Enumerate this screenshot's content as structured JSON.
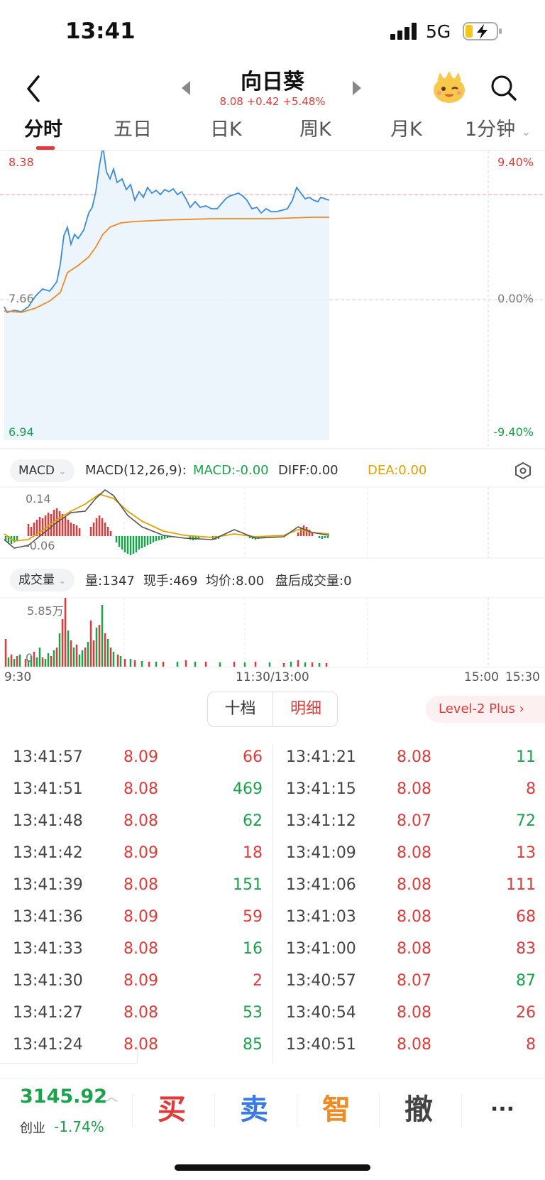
{
  "status_bar": {
    "time": "13:41",
    "network": "5G"
  },
  "header": {
    "stock_name": "向日葵",
    "quote": "8.08 +0.42 +5.48%"
  },
  "tabs": [
    {
      "label": "分时"
    },
    {
      "label": "五日"
    },
    {
      "label": "日K"
    },
    {
      "label": "周K"
    },
    {
      "label": "月K"
    },
    {
      "label": "1分钟"
    }
  ],
  "price_chart": {
    "high_price": "8.38",
    "mid_price": "7.66",
    "low_price": "6.94",
    "high_pct": "9.40%",
    "mid_pct": "0.00%",
    "low_pct": "-9.40%"
  },
  "macd": {
    "selector": "MACD",
    "params": "MACD(12,26,9):",
    "macd_value": "MACD:-0.00",
    "diff_value": "DIFF:0.00",
    "dea_value": "DEA:0.00",
    "top_label": "0.14",
    "bottom_label": "-0.06"
  },
  "volume": {
    "selector": "成交量",
    "amount": "量:1347",
    "current_hand": "现手:469",
    "avg_price": "均价:8.00",
    "after_hours": "盘后成交量:0",
    "max_label": "5.85万",
    "zero_label": "0"
  },
  "time_axis": {
    "start": "9:30",
    "mid": "11:30/13:00",
    "t1500": "15:00",
    "t1530": "15:30"
  },
  "detail_tabs": {
    "left": "十档",
    "right": "明细"
  },
  "level2": "Level-2 Plus",
  "trades_left": [
    {
      "time": "13:41:57",
      "price": "8.09",
      "vol": "66",
      "dir": "red"
    },
    {
      "time": "13:41:51",
      "price": "8.08",
      "vol": "469",
      "dir": "green"
    },
    {
      "time": "13:41:48",
      "price": "8.08",
      "vol": "62",
      "dir": "green"
    },
    {
      "time": "13:41:42",
      "price": "8.09",
      "vol": "18",
      "dir": "red"
    },
    {
      "time": "13:41:39",
      "price": "8.08",
      "vol": "151",
      "dir": "green"
    },
    {
      "time": "13:41:36",
      "price": "8.09",
      "vol": "59",
      "dir": "red"
    },
    {
      "time": "13:41:33",
      "price": "8.08",
      "vol": "16",
      "dir": "green"
    },
    {
      "time": "13:41:30",
      "price": "8.09",
      "vol": "2",
      "dir": "red"
    },
    {
      "time": "13:41:27",
      "price": "8.08",
      "vol": "53",
      "dir": "green"
    },
    {
      "time": "13:41:24",
      "price": "8.08",
      "vol": "85",
      "dir": "green"
    }
  ],
  "trades_right": [
    {
      "time": "13:41:21",
      "price": "8.08",
      "vol": "11",
      "dir": "green"
    },
    {
      "time": "13:41:15",
      "price": "8.08",
      "vol": "8",
      "dir": "red"
    },
    {
      "time": "13:41:12",
      "price": "8.07",
      "vol": "72",
      "dir": "green"
    },
    {
      "time": "13:41:09",
      "price": "8.08",
      "vol": "13",
      "dir": "red"
    },
    {
      "time": "13:41:06",
      "price": "8.08",
      "vol": "111",
      "dir": "red"
    },
    {
      "time": "13:41:03",
      "price": "8.08",
      "vol": "68",
      "dir": "red"
    },
    {
      "time": "13:41:00",
      "price": "8.08",
      "vol": "83",
      "dir": "red"
    },
    {
      "time": "13:40:57",
      "price": "8.07",
      "vol": "87",
      "dir": "green"
    },
    {
      "time": "13:40:54",
      "price": "8.08",
      "vol": "26",
      "dir": "red"
    },
    {
      "time": "13:40:51",
      "price": "8.08",
      "vol": "8",
      "dir": "red"
    }
  ],
  "index": {
    "value": "3145.92",
    "name": "创业",
    "change": "-1.74%"
  },
  "actions": {
    "buy": "买",
    "sell": "卖",
    "smart": "智",
    "cancel": "撤",
    "more": "···"
  },
  "colors": {
    "up": "#e23a3a",
    "down": "#19a34a",
    "price_line": "#3a8be0",
    "avg_line": "#f08a24"
  }
}
